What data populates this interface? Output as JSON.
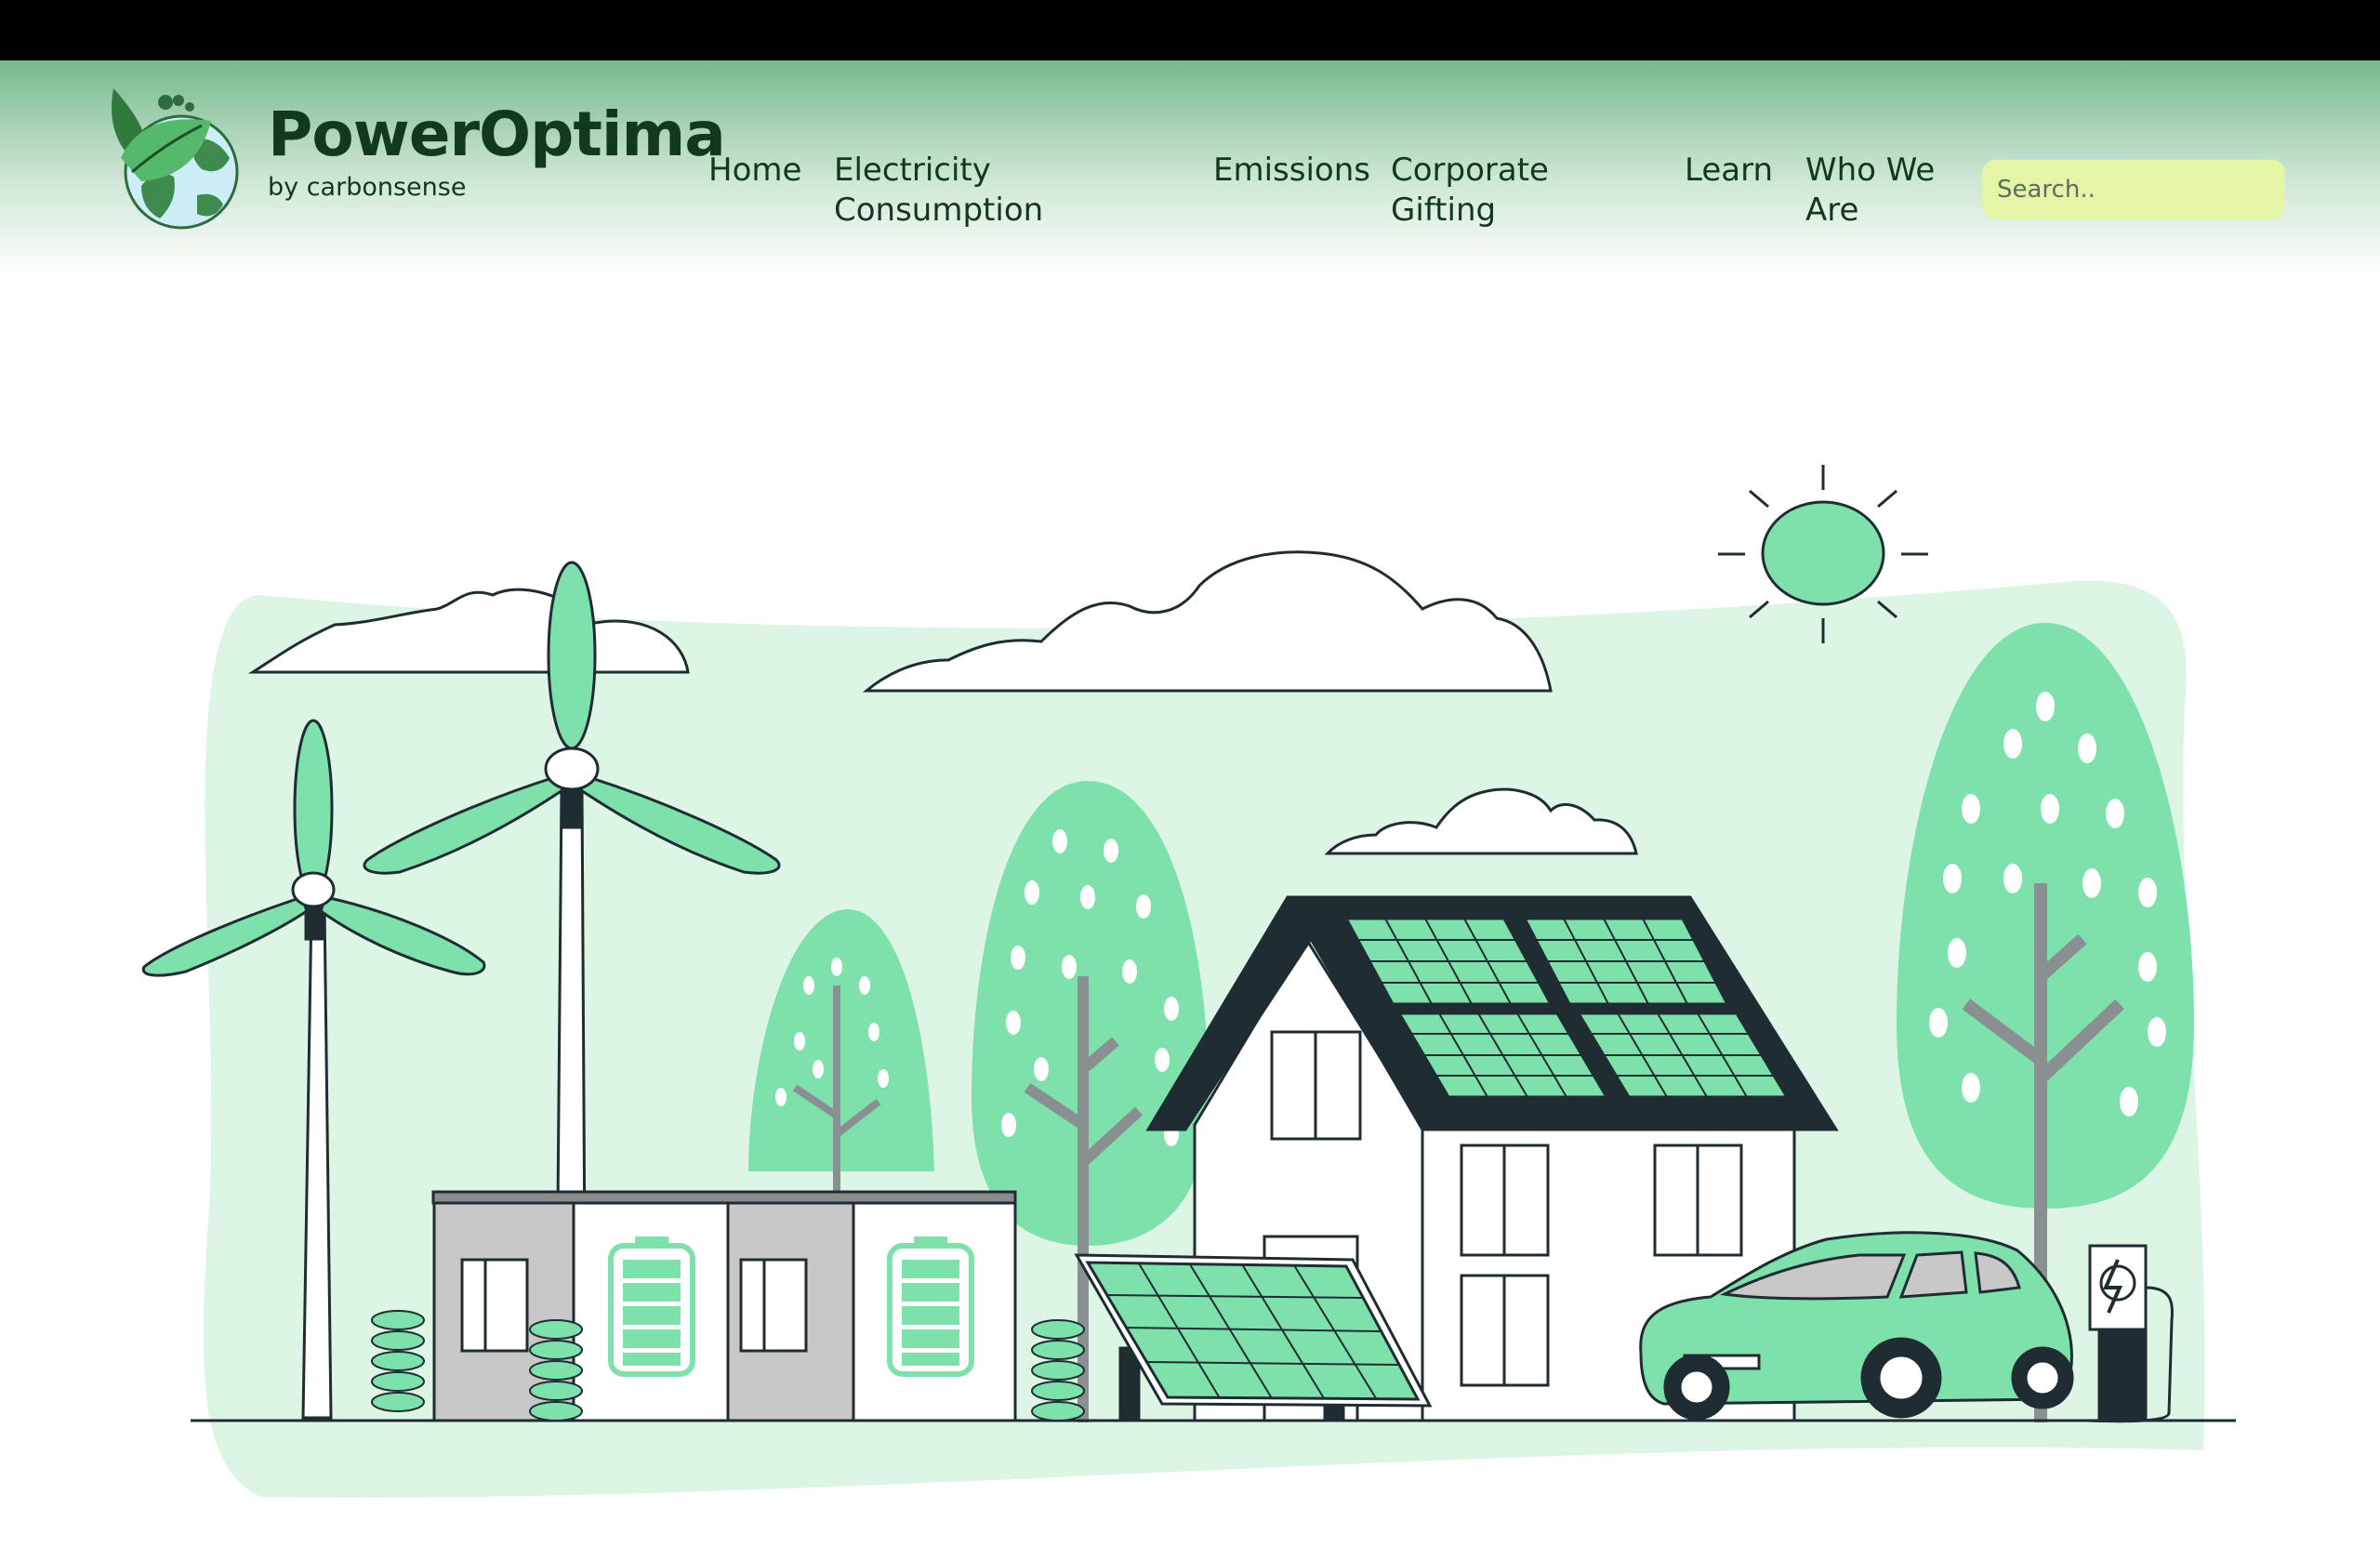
{
  "brand": {
    "name": "PowerOptima",
    "tagline": "by carbonsense"
  },
  "nav": {
    "home": "Home",
    "electricity": [
      "Electricity",
      "Consumption"
    ],
    "emissions": "Emissions",
    "gifting": [
      "Corporate",
      "Gifting"
    ],
    "learn": "Learn",
    "who": [
      "Who We",
      "Are"
    ]
  },
  "search": {
    "placeholder": "Search..",
    "value": ""
  },
  "colors": {
    "header_top": "#77b98f",
    "accent_green": "#7ee0ab",
    "light_green": "#dcf5e5",
    "dark": "#1f2d33",
    "search_bg": "#e4f5a8"
  },
  "icons": [
    "earth-leaf-logo-icon",
    "sun-icon",
    "wind-turbine-icon",
    "battery-icon",
    "solar-panel-icon",
    "electric-car-icon",
    "charging-station-icon",
    "lightning-icon"
  ]
}
